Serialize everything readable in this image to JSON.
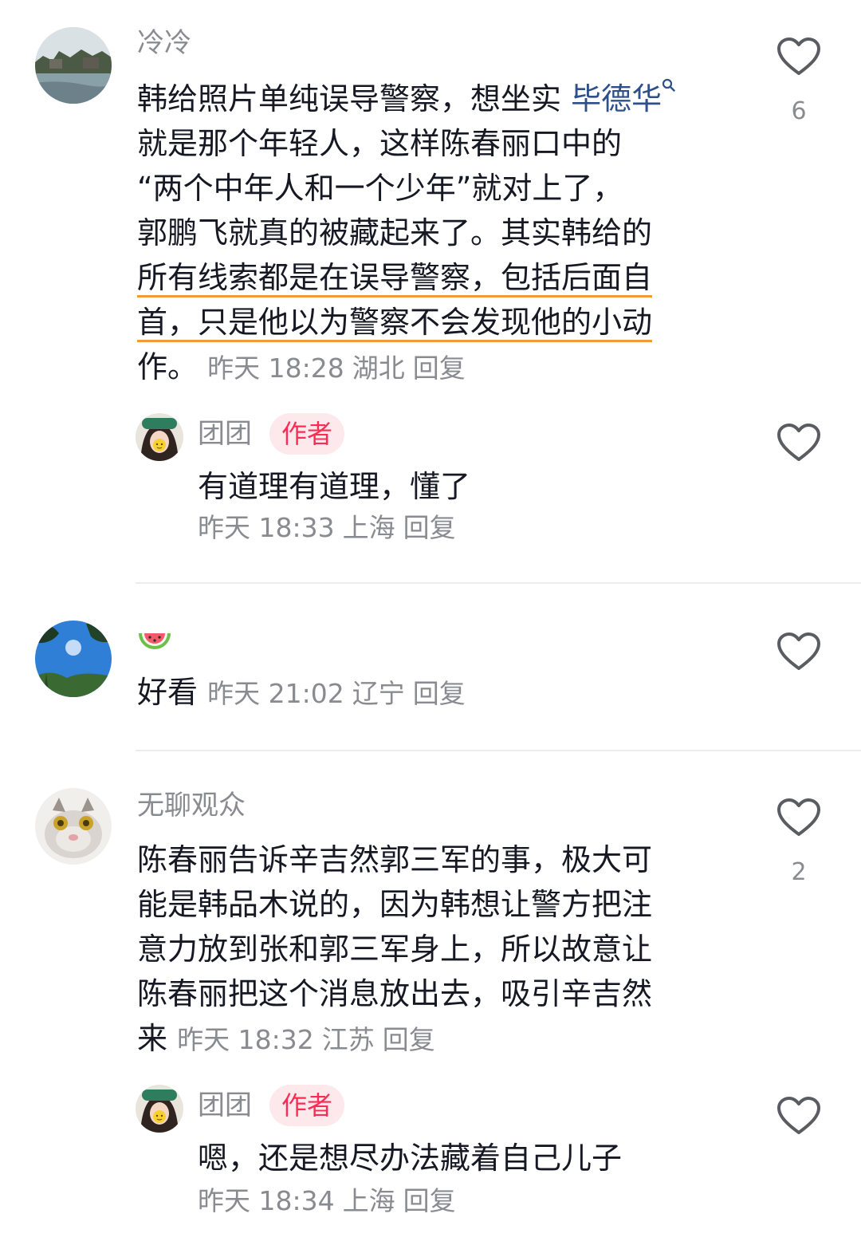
{
  "comments": [
    {
      "name": "冷冷",
      "text_lines": [
        "韩给照片单纯误导警察，想坐实 ",
        "就是那个年轻人，这样陈春丽口中的",
        "“两个中年人和一个少年”就对上了，",
        "郭鹏飞就真的被藏起来了。其实韩给的",
        "所有线索都是在误导警察，包括后面自",
        "首，只是他以为警察不会发现他的小动",
        "作。"
      ],
      "link": "毕德华",
      "time": "昨天 18:28",
      "location": "湖北",
      "reply_label": "回复",
      "likes": "6",
      "reply": {
        "name": "团团",
        "badge": "作者",
        "text": "有道理有道理，懂了",
        "time": "昨天 18:33",
        "location": "上海",
        "reply_label": "回复"
      }
    },
    {
      "name": "",
      "name_emoji": "watermelon-emoji",
      "text": "好看",
      "time": "昨天 21:02",
      "location": "辽宁",
      "reply_label": "回复"
    },
    {
      "name": "无聊观众",
      "text_lines": [
        "陈春丽告诉辛吉然郭三军的事，极大可",
        "能是韩品木说的，因为韩想让警方把注",
        "意力放到张和郭三军身上，所以故意让",
        "陈春丽把这个消息放出去，吸引辛吉然",
        "来"
      ],
      "time": "昨天 18:32",
      "location": "江苏",
      "reply_label": "回复",
      "likes": "2",
      "reply": {
        "name": "团团",
        "badge": "作者",
        "text": "嗯，还是想尽办法藏着自己儿子",
        "time": "昨天 18:34",
        "location": "上海",
        "reply_label": "回复"
      }
    }
  ],
  "colors": {
    "accent": "#fe2c55",
    "badge_bg": "#fde8ec",
    "link": "#2e4f89",
    "underline": "#f29a34",
    "meta": "#8a8b91"
  },
  "icons": [
    "heart-outline-icon",
    "search-icon",
    "watermelon-emoji"
  ]
}
